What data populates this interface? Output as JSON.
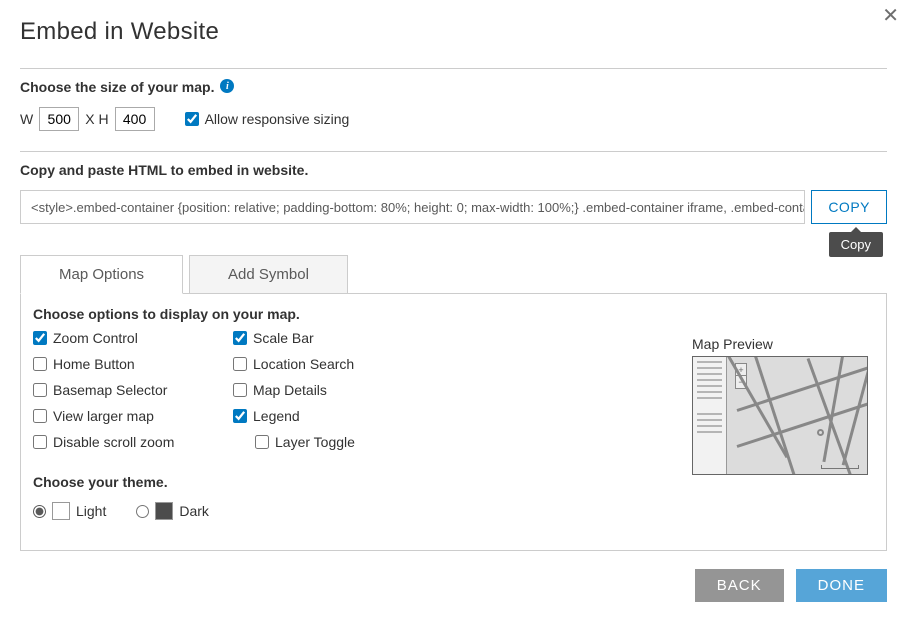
{
  "title": "Embed in Website",
  "size": {
    "label": "Choose the size of your map.",
    "w_label": "W",
    "w_value": "500",
    "xh_label": "X  H",
    "h_value": "400",
    "responsive_label": "Allow responsive sizing",
    "responsive_checked": true
  },
  "embed": {
    "label": "Copy and paste HTML to embed in website.",
    "code": "<style>.embed-container {position: relative; padding-bottom: 80%; height: 0; max-width: 100%;} .embed-container iframe, .embed-container ob",
    "copy_label": "COPY",
    "tooltip": "Copy"
  },
  "tabs": {
    "map_options": "Map Options",
    "add_symbol": "Add Symbol"
  },
  "options": {
    "heading": "Choose options to display on your map.",
    "col1": [
      {
        "label": "Zoom Control",
        "checked": true
      },
      {
        "label": "Home Button",
        "checked": false
      },
      {
        "label": "Basemap Selector",
        "checked": false
      },
      {
        "label": "View larger map",
        "checked": false
      },
      {
        "label": "Disable scroll zoom",
        "checked": false
      }
    ],
    "col2": [
      {
        "label": "Scale Bar",
        "checked": true,
        "indent": false
      },
      {
        "label": "Location Search",
        "checked": false,
        "indent": false
      },
      {
        "label": "Map Details",
        "checked": false,
        "indent": false
      },
      {
        "label": "Legend",
        "checked": true,
        "indent": false
      },
      {
        "label": "Layer Toggle",
        "checked": false,
        "indent": true
      }
    ]
  },
  "theme": {
    "heading": "Choose your theme.",
    "light_label": "Light",
    "dark_label": "Dark",
    "selected": "light"
  },
  "preview": {
    "label": "Map Preview"
  },
  "footer": {
    "back": "BACK",
    "done": "DONE"
  }
}
